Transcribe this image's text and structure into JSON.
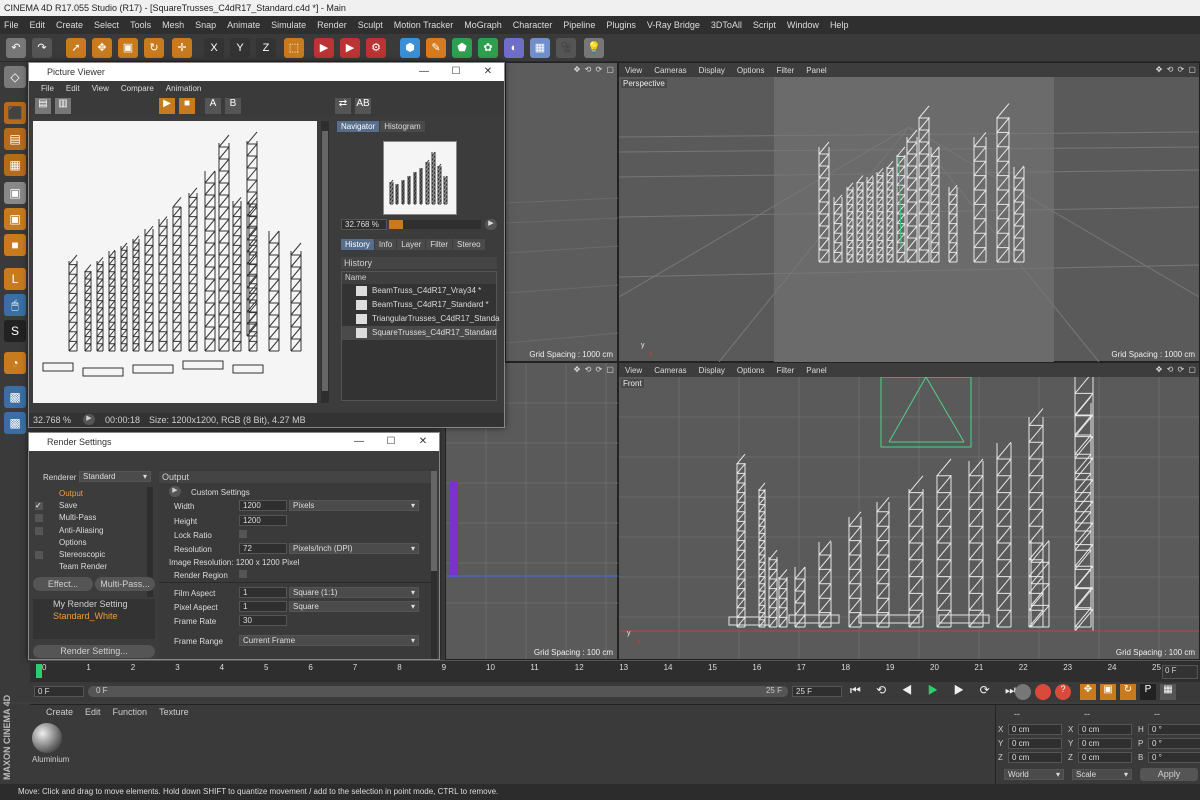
{
  "app_title": "CINEMA 4D R17.055 Studio (R17) - [SquareTrusses_C4dR17_Standard.c4d *] - Main",
  "menu": [
    "File",
    "Edit",
    "Create",
    "Select",
    "Tools",
    "Mesh",
    "Snap",
    "Animate",
    "Simulate",
    "Render",
    "Sculpt",
    "Motion Tracker",
    "MoGraph",
    "Character",
    "Pipeline",
    "Plugins",
    "V-Ray Bridge",
    "3DToAll",
    "Script",
    "Window",
    "Help"
  ],
  "toolbar_icons": [
    "undo-icon",
    "redo-icon",
    "select-icon",
    "move-icon",
    "scale-icon",
    "rotate-icon",
    "recent-tool-icon",
    "x-axis-icon",
    "y-axis-icon",
    "z-axis-icon",
    "coordinate-system-icon",
    "render-view-icon",
    "render-picture-viewer-icon",
    "edit-render-settings-icon",
    "cube-icon",
    "pen-icon",
    "subdivision-icon",
    "cloner-icon",
    "deformer-icon",
    "floor-icon",
    "camera-icon",
    "light-icon"
  ],
  "toolbar_glyphs": [
    "↶",
    "↷",
    "➚",
    "✥",
    "▣",
    "↻",
    "✛",
    "X",
    "Y",
    "Z",
    "⬚",
    "▶",
    "▶",
    "⚙",
    "⬢",
    "✎",
    "⬟",
    "✿",
    "◐",
    "▦",
    "🎥",
    "💡"
  ],
  "viewport_menu": [
    "View",
    "Cameras",
    "Display",
    "Options",
    "Filter",
    "Panel"
  ],
  "viewports": {
    "perspective": {
      "label": "Perspective",
      "grid": "Grid Spacing : 1000 cm"
    },
    "top_left": {
      "grid": "Grid Spacing : 1000 cm"
    },
    "front": {
      "label": "Front",
      "grid": "Grid Spacing : 100 cm"
    },
    "bottom_left": {
      "grid": "Grid Spacing : 100 cm"
    }
  },
  "picture_viewer": {
    "title": "Picture Viewer",
    "menu": [
      "File",
      "Edit",
      "View",
      "Compare",
      "Animation"
    ],
    "tabs_top": [
      "Navigator",
      "Histogram"
    ],
    "zoom": "32.768 %",
    "tabs_mid": [
      "History",
      "Info",
      "Layer",
      "Filter",
      "Stereo"
    ],
    "history_label": "History",
    "col_name": "Name",
    "history": [
      "BeamTruss_C4dR17_Vray34 *",
      "BeamTruss_C4dR17_Standard *",
      "TriangularTrusses_C4dR17_Standa",
      "SquareTrusses_C4dR17_Standard"
    ],
    "status_zoom": "32.768 %",
    "status_time": "00:00:18",
    "status_info": "Size: 1200x1200, RGB (8 Bit), 4.27 MB"
  },
  "render_settings": {
    "title": "Render Settings",
    "renderer_label": "Renderer",
    "renderer": "Standard",
    "items": [
      "Output",
      "Save",
      "Multi-Pass",
      "Anti-Aliasing",
      "Options",
      "Stereoscopic",
      "Team Render"
    ],
    "effect_btn": "Effect...",
    "multipass_btn": "Multi-Pass...",
    "presets": [
      "My Render Setting",
      "Standard_White"
    ],
    "render_setting_btn": "Render Setting...",
    "section": "Output",
    "custom": "Custom Settings",
    "width_label": "Width",
    "width": "1200",
    "width_unit": "Pixels",
    "height_label": "Height",
    "height": "1200",
    "lock_label": "Lock Ratio",
    "res_label": "Resolution",
    "res": "72",
    "res_unit": "Pixels/Inch (DPI)",
    "img_res": "Image Resolution: 1200 x 1200 Pixel",
    "region_label": "Render Region",
    "film_label": "Film Aspect",
    "film": "1",
    "film_unit": "Square (1:1)",
    "pixel_label": "Pixel Aspect",
    "pixel": "1",
    "pixel_unit": "Square",
    "fps_label": "Frame Rate",
    "fps": "30",
    "range_label": "Frame Range",
    "range": "Current Frame"
  },
  "timeline": {
    "ticks": [
      "0",
      "1",
      "2",
      "3",
      "4",
      "5",
      "6",
      "7",
      "8",
      "9",
      "10",
      "11",
      "12",
      "13",
      "14",
      "15",
      "16",
      "17",
      "18",
      "19",
      "20",
      "21",
      "22",
      "23",
      "24",
      "25"
    ],
    "end_label": "0 F",
    "start_field": "0 F",
    "min_field": "0 F",
    "max_field": "25 F",
    "end_field": "25 F"
  },
  "material_menu": [
    "Create",
    "Edit",
    "Function",
    "Texture"
  ],
  "material_name": "Aluminium",
  "coords": {
    "dash": "--",
    "rows": [
      [
        "X",
        "0 cm",
        "X",
        "0 cm",
        "H",
        "0 °"
      ],
      [
        "Y",
        "0 cm",
        "Y",
        "0 cm",
        "P",
        "0 °"
      ],
      [
        "Z",
        "0 cm",
        "Z",
        "0 cm",
        "B",
        "0 °"
      ]
    ],
    "world": "World",
    "scale": "Scale",
    "apply": "Apply"
  },
  "status": "Move: Click and drag to move elements. Hold down SHIFT to quantize movement / add to the selection in point mode, CTRL to remove.",
  "maxon": "MAXON CINEMA 4D"
}
